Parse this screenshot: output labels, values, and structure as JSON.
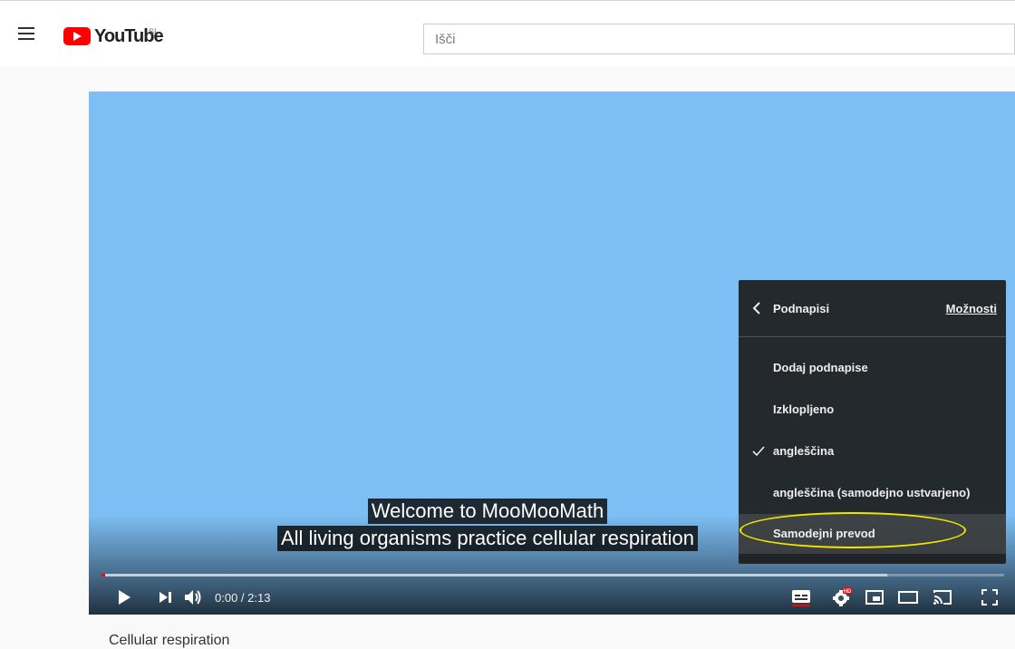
{
  "header": {
    "logo_text": "YouTube",
    "logo_region": "SI",
    "search_placeholder": "Išči",
    "icons": {
      "menu": "hamburger-menu-icon",
      "logo": "youtube-play-icon"
    }
  },
  "player": {
    "background_color": "#7dbff5",
    "captions": [
      "Welcome to MooMooMath",
      "All living organisms practice cellular respiration"
    ],
    "time_current": "0:00",
    "time_sep": " / ",
    "time_total": "2:13",
    "progress_fraction": 0.0,
    "buffered_fraction": 0.87,
    "controls_icons": [
      "play-icon",
      "next-icon",
      "volume-icon",
      "subtitles-icon",
      "settings-icon",
      "miniplayer-icon",
      "theater-icon",
      "cast-icon",
      "fullscreen-icon"
    ],
    "hd_badge": "HD"
  },
  "settings_menu": {
    "title": "Podnapisi",
    "options_link": "Možnosti",
    "items": [
      {
        "label": "Dodaj podnapise",
        "checked": false
      },
      {
        "label": "Izklopljeno",
        "checked": false
      },
      {
        "label": "angleščina",
        "checked": true
      },
      {
        "label": "angleščina (samodejno ustvarjeno)",
        "checked": false
      },
      {
        "label": "Samodejni prevod",
        "checked": false,
        "highlighted": true
      }
    ],
    "annotation_color": "#f2e600"
  },
  "video_title_partial": "Cellular respiration"
}
